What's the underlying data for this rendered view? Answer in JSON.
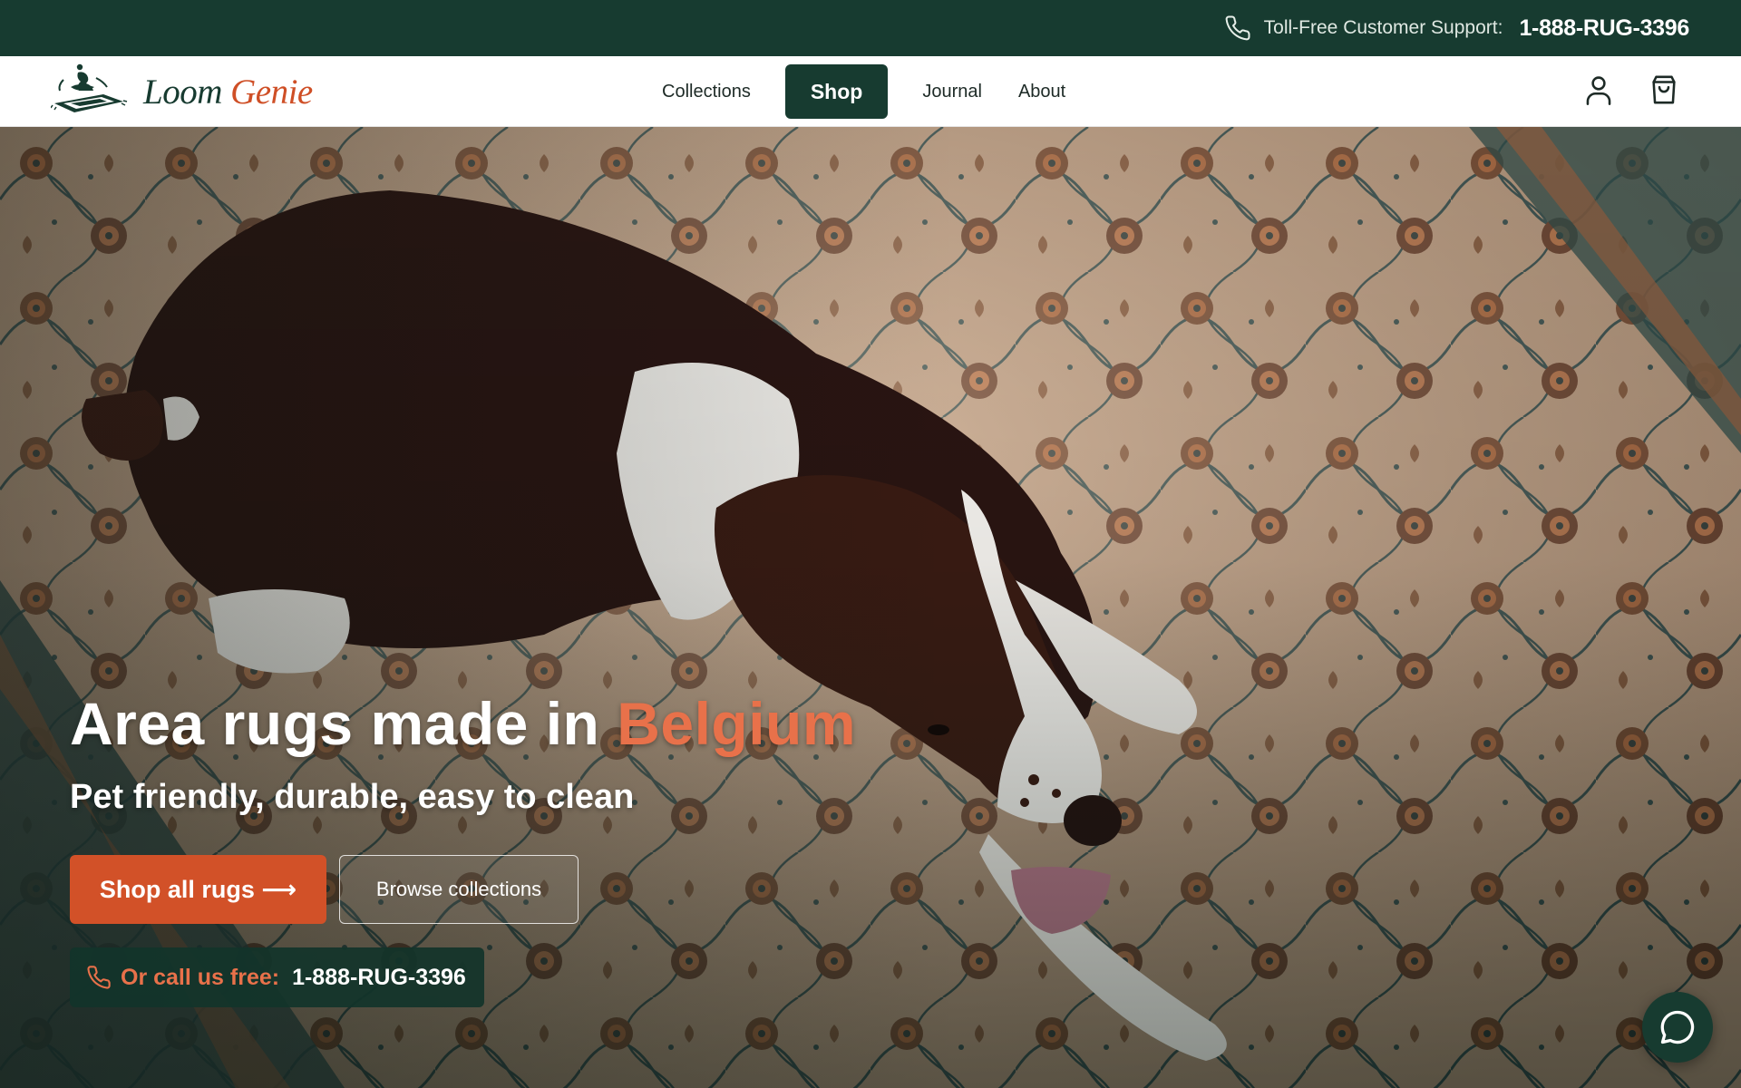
{
  "topbar": {
    "support_label": "Toll-Free Customer Support:",
    "support_number": "1-888-RUG-3396",
    "icon": "phone-icon"
  },
  "header": {
    "logo": {
      "word_primary": "Loom",
      "word_accent": "Genie"
    },
    "nav": [
      {
        "label": "Collections",
        "active": false
      },
      {
        "label": "Shop",
        "active": true
      },
      {
        "label": "Journal",
        "active": false
      },
      {
        "label": "About",
        "active": false
      }
    ],
    "icons": [
      "account-icon",
      "cart-icon"
    ]
  },
  "hero": {
    "title_main": "Area rugs made in",
    "title_accent": "Belgium",
    "subtitle": "Pet friendly, durable, easy to clean",
    "primary_cta": "Shop all rugs ⟶",
    "secondary_cta": "Browse collections",
    "call_label": "Or call us free:",
    "call_number": "1-888-RUG-3396"
  },
  "chat": {
    "icon": "chat-bubble-icon"
  },
  "colors": {
    "brand_green": "#173b30",
    "accent_orange": "#d25128",
    "accent_orange_light": "#e8714a",
    "white": "#ffffff"
  }
}
